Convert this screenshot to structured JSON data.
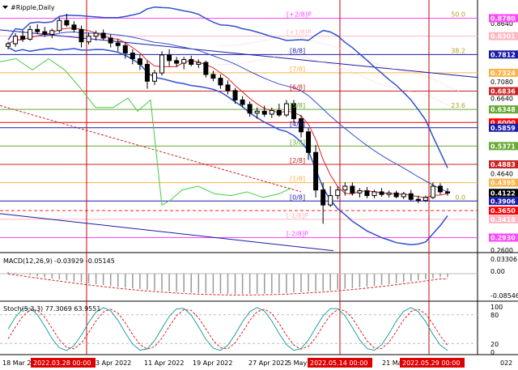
{
  "header": {
    "title": "#Ripple,Daily",
    "menu_icon": "triangle-down-icon"
  },
  "price_axis": {
    "labels": [
      {
        "v": 0.878,
        "t": "0.8780"
      },
      {
        "v": 0.864,
        "t": "0.8640"
      },
      {
        "v": 0.8301,
        "t": "0.8301"
      },
      {
        "v": 0.7812,
        "t": "0.7812"
      },
      {
        "v": 0.7324,
        "t": "0.7324"
      },
      {
        "v": 0.708,
        "t": "0.7080"
      },
      {
        "v": 0.6836,
        "t": "0.6836"
      },
      {
        "v": 0.664,
        "t": "0.6640"
      },
      {
        "v": 0.6348,
        "t": "0.6348"
      },
      {
        "v": 0.6,
        "t": "0.6000"
      },
      {
        "v": 0.5859,
        "t": "0.5859"
      },
      {
        "v": 0.5371,
        "t": "0.5371"
      },
      {
        "v": 0.4883,
        "t": "0.4883"
      },
      {
        "v": 0.464,
        "t": "0.4640"
      },
      {
        "v": 0.4395,
        "t": "0.4395"
      },
      {
        "v": 0.4122,
        "t": "0.4122"
      },
      {
        "v": 0.3906,
        "t": "0.3906"
      },
      {
        "v": 0.365,
        "t": "0.3650"
      },
      {
        "v": 0.3418,
        "t": "0.3418"
      },
      {
        "v": 0.293,
        "t": "0.2930"
      },
      {
        "v": 0.26,
        "t": "0.2600"
      }
    ],
    "boxes": [
      {
        "v": 0.878,
        "color": "#ff44ff"
      },
      {
        "v": 0.8301,
        "color": "#ffb6c1"
      },
      {
        "v": 0.7812,
        "color": "#1a1aa8"
      },
      {
        "v": 0.7324,
        "color": "#ffb347"
      },
      {
        "v": 0.6836,
        "color": "#cc2222"
      },
      {
        "v": 0.6348,
        "color": "#66aa33"
      },
      {
        "v": 0.6,
        "color": "#ff0000"
      },
      {
        "v": 0.5859,
        "color": "#1a1aa8"
      },
      {
        "v": 0.5371,
        "color": "#66aa33"
      },
      {
        "v": 0.4883,
        "color": "#cc2222"
      },
      {
        "v": 0.4395,
        "color": "#ffb347"
      },
      {
        "v": 0.4122,
        "color": "#000000"
      },
      {
        "v": 0.3906,
        "color": "#1a1aa8"
      },
      {
        "v": 0.365,
        "color": "#ff0000"
      },
      {
        "v": 0.3418,
        "color": "#ffb6c1"
      },
      {
        "v": 0.293,
        "color": "#ff44ff"
      }
    ]
  },
  "murrey_levels": [
    {
      "v": 0.878,
      "label": "[+2/8]P",
      "color": "#ff44ff"
    },
    {
      "v": 0.8301,
      "label": "[+1/8]P",
      "color": "#ffb6c1"
    },
    {
      "v": 0.7812,
      "label": "[8/8]",
      "color": "#1a1aa8"
    },
    {
      "v": 0.7324,
      "label": "[7/8]",
      "color": "#ffb347"
    },
    {
      "v": 0.6836,
      "label": "[6/8]",
      "color": "#cc2222"
    },
    {
      "v": 0.6348,
      "label": "[5/8]",
      "color": "#66aa33"
    },
    {
      "v": 0.5859,
      "label": "[4/8]",
      "color": "#1a1aa8"
    },
    {
      "v": 0.5371,
      "label": "[3/8]",
      "color": "#66aa33"
    },
    {
      "v": 0.4883,
      "label": "[2/8]",
      "color": "#cc2222"
    },
    {
      "v": 0.4395,
      "label": "[1/8]",
      "color": "#ffb347"
    },
    {
      "v": 0.3906,
      "label": "[0/8]",
      "color": "#1a1aa8"
    },
    {
      "v": 0.3418,
      "label": "[-1/8]P",
      "color": "#ffb6c1"
    },
    {
      "v": 0.293,
      "label": "[-2/8]P",
      "color": "#ff44ff"
    }
  ],
  "fib_labels": [
    {
      "v": 0.878,
      "t": "50.0"
    },
    {
      "v": 0.7812,
      "t": "38.2"
    },
    {
      "v": 0.6348,
      "t": "23.6"
    },
    {
      "v": 0.3906,
      "t": "0.0"
    }
  ],
  "candles": [
    [
      0.803,
      0.815,
      0.795,
      0.81
    ],
    [
      0.81,
      0.838,
      0.802,
      0.83
    ],
    [
      0.83,
      0.845,
      0.815,
      0.822
    ],
    [
      0.822,
      0.858,
      0.818,
      0.848
    ],
    [
      0.848,
      0.862,
      0.835,
      0.842
    ],
    [
      0.842,
      0.855,
      0.828,
      0.835
    ],
    [
      0.835,
      0.85,
      0.825,
      0.845
    ],
    [
      0.845,
      0.88,
      0.84,
      0.872
    ],
    [
      0.872,
      0.89,
      0.855,
      0.86
    ],
    [
      0.86,
      0.87,
      0.84,
      0.848
    ],
    [
      0.848,
      0.858,
      0.8,
      0.815
    ],
    [
      0.815,
      0.84,
      0.808,
      0.83
    ],
    [
      0.83,
      0.845,
      0.818,
      0.838
    ],
    [
      0.838,
      0.848,
      0.82,
      0.825
    ],
    [
      0.825,
      0.835,
      0.8,
      0.812
    ],
    [
      0.812,
      0.822,
      0.79,
      0.805
    ],
    [
      0.805,
      0.815,
      0.77,
      0.785
    ],
    [
      0.785,
      0.795,
      0.755,
      0.77
    ],
    [
      0.77,
      0.78,
      0.74,
      0.755
    ],
    [
      0.755,
      0.765,
      0.69,
      0.71
    ],
    [
      0.71,
      0.74,
      0.7,
      0.732
    ],
    [
      0.732,
      0.79,
      0.725,
      0.78
    ],
    [
      0.78,
      0.795,
      0.75,
      0.765
    ],
    [
      0.765,
      0.775,
      0.748,
      0.758
    ],
    [
      0.758,
      0.775,
      0.742,
      0.768
    ],
    [
      0.768,
      0.778,
      0.75,
      0.755
    ],
    [
      0.755,
      0.768,
      0.745,
      0.76
    ],
    [
      0.76,
      0.765,
      0.72,
      0.728
    ],
    [
      0.728,
      0.738,
      0.71,
      0.718
    ],
    [
      0.718,
      0.728,
      0.69,
      0.7
    ],
    [
      0.7,
      0.712,
      0.675,
      0.685
    ],
    [
      0.685,
      0.692,
      0.65,
      0.66
    ],
    [
      0.66,
      0.67,
      0.64,
      0.648
    ],
    [
      0.648,
      0.656,
      0.615,
      0.625
    ],
    [
      0.625,
      0.64,
      0.61,
      0.63
    ],
    [
      0.63,
      0.645,
      0.615,
      0.622
    ],
    [
      0.622,
      0.64,
      0.612,
      0.632
    ],
    [
      0.632,
      0.65,
      0.615,
      0.62
    ],
    [
      0.62,
      0.66,
      0.615,
      0.65
    ],
    [
      0.65,
      0.66,
      0.6,
      0.61
    ],
    [
      0.61,
      0.62,
      0.56,
      0.575
    ],
    [
      0.575,
      0.585,
      0.5,
      0.52
    ],
    [
      0.52,
      0.54,
      0.4,
      0.42
    ],
    [
      0.42,
      0.44,
      0.33,
      0.38
    ],
    [
      0.38,
      0.43,
      0.375,
      0.405
    ],
    [
      0.405,
      0.43,
      0.395,
      0.42
    ],
    [
      0.42,
      0.44,
      0.405,
      0.43
    ],
    [
      0.43,
      0.44,
      0.405,
      0.412
    ],
    [
      0.412,
      0.425,
      0.4,
      0.418
    ],
    [
      0.418,
      0.428,
      0.398,
      0.405
    ],
    [
      0.405,
      0.42,
      0.398,
      0.415
    ],
    [
      0.415,
      0.425,
      0.402,
      0.408
    ],
    [
      0.408,
      0.418,
      0.4,
      0.412
    ],
    [
      0.412,
      0.418,
      0.398,
      0.402
    ],
    [
      0.402,
      0.415,
      0.396,
      0.41
    ],
    [
      0.41,
      0.42,
      0.39,
      0.395
    ],
    [
      0.395,
      0.405,
      0.385,
      0.392
    ],
    [
      0.392,
      0.405,
      0.388,
      0.4
    ],
    [
      0.4,
      0.44,
      0.396,
      0.43
    ],
    [
      0.43,
      0.438,
      0.408,
      0.415
    ],
    [
      0.415,
      0.425,
      0.405,
      0.412
    ]
  ],
  "macd": {
    "label": "MACD(12,26,9) -0.03929 -0.05145",
    "axis": [
      "0.03306",
      "0.00",
      "-0.08546"
    ]
  },
  "stoch": {
    "label": "Stoch(5,3,3) 77.3069 63.9551",
    "axis": [
      "100",
      "80",
      "20",
      "0"
    ]
  },
  "time_axis": {
    "labels": [
      "18 Mar 20",
      "3 Apr 2022",
      "11 Apr 2022",
      "19 Apr 2022",
      "27 Apr 2022",
      "5 May 2",
      "21 Ma",
      "022"
    ],
    "highlights": [
      "2022.03.28 00:00",
      "2022.05.14 00:00",
      "2022.05.29 00:00"
    ]
  },
  "colors": {
    "murrey_red": "#cc2222",
    "bollinger": "#3050d0",
    "ma_red": "#dd2222",
    "rsi_green": "#44cc44",
    "trend_navy": "#1a1aa8",
    "marker": "#cc0000"
  }
}
